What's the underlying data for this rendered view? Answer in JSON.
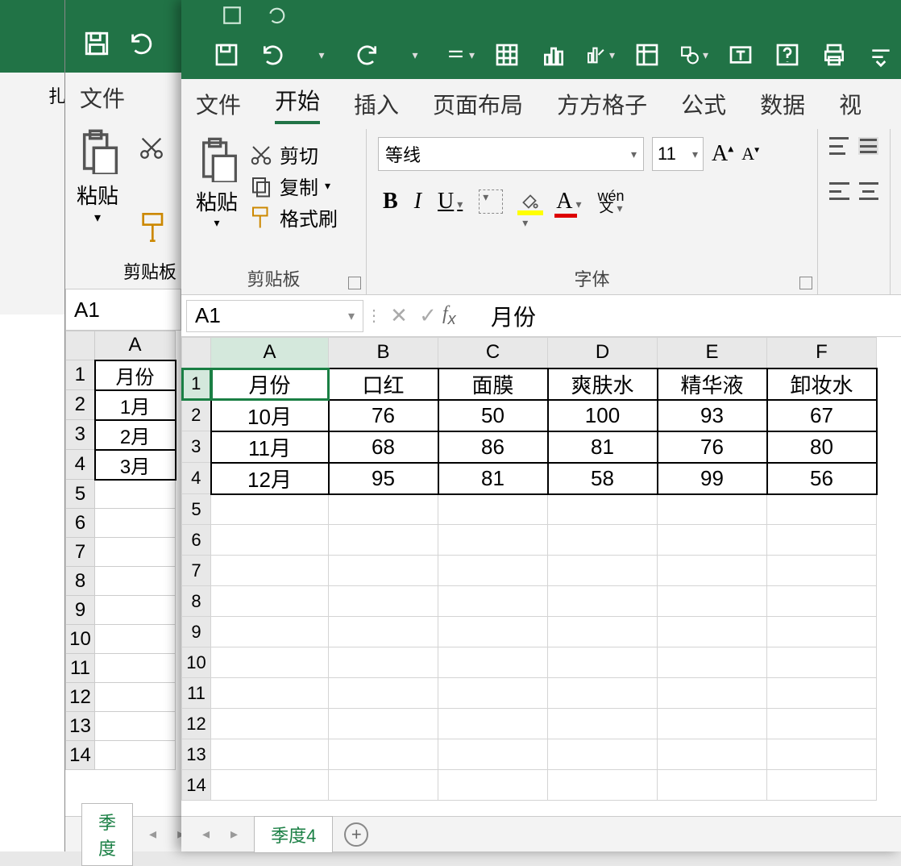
{
  "windowA": {
    "menu_partial": "扎"
  },
  "windowB": {
    "menu_file": "文件",
    "paste": "粘贴",
    "clipboard_group": "剪贴板",
    "namebox": "A1",
    "col_label": "A",
    "rows_partial": [
      "月份",
      "1月",
      "2月",
      "3月"
    ],
    "row_numbers": [
      "1",
      "2",
      "3",
      "4",
      "5",
      "6",
      "7",
      "8",
      "9",
      "10",
      "11",
      "12",
      "13",
      "14"
    ],
    "sheet_tab_partial": "季度"
  },
  "windowC": {
    "menu": {
      "file": "文件",
      "home": "开始",
      "insert": "插入",
      "layout": "页面布局",
      "fangfang": "方方格子",
      "formula": "公式",
      "data": "数据",
      "view_partial": "视"
    },
    "ribbon": {
      "paste": "粘贴",
      "cut": "剪切",
      "copy": "复制",
      "format_painter": "格式刷",
      "clipboard_group": "剪贴板",
      "font_name": "等线",
      "font_size": "11",
      "bold": "B",
      "italic": "I",
      "underline": "U",
      "wen_top": "wén",
      "wen_bottom": "文",
      "font_group": "字体"
    },
    "namebox": "A1",
    "formula_value": "月份",
    "columns": [
      "A",
      "B",
      "C",
      "D",
      "E",
      "F"
    ],
    "headers": [
      "月份",
      "口红",
      "面膜",
      "爽肤水",
      "精华液",
      "卸妆水"
    ],
    "data_rows": [
      [
        "10月",
        "76",
        "50",
        "100",
        "93",
        "67"
      ],
      [
        "11月",
        "68",
        "86",
        "81",
        "76",
        "80"
      ],
      [
        "12月",
        "95",
        "81",
        "58",
        "99",
        "56"
      ]
    ],
    "row_numbers": [
      "1",
      "2",
      "3",
      "4",
      "5",
      "6",
      "7",
      "8",
      "9",
      "10",
      "11",
      "12",
      "13",
      "14"
    ],
    "sheet_tab": "季度4",
    "colors": {
      "fill_highlight": "#ffff00",
      "font_color": "#d00000"
    }
  },
  "chart_data": {
    "type": "table",
    "title": "",
    "columns": [
      "月份",
      "口红",
      "面膜",
      "爽肤水",
      "精华液",
      "卸妆水"
    ],
    "rows": [
      {
        "月份": "10月",
        "口红": 76,
        "面膜": 50,
        "爽肤水": 100,
        "精华液": 93,
        "卸妆水": 67
      },
      {
        "月份": "11月",
        "口红": 68,
        "面膜": 86,
        "爽肤水": 81,
        "精华液": 76,
        "卸妆水": 80
      },
      {
        "月份": "12月",
        "口红": 95,
        "面膜": 81,
        "爽肤水": 58,
        "精华液": 99,
        "卸妆水": 56
      }
    ]
  }
}
